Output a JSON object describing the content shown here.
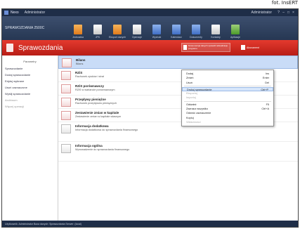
{
  "credit": "fot. InsERT",
  "window": {
    "app_name": "Nexo",
    "app_subtitle": "Administrator",
    "user": "Administrator",
    "controls": [
      "?",
      "–",
      "□",
      "×"
    ]
  },
  "ribbon": {
    "company": "SPRAWOZDANIA 2500C",
    "tools": [
      {
        "label": "Jednostka",
        "color": "orange"
      },
      {
        "label": "JPK",
        "color": "white"
      },
      {
        "label": "Eksport danych",
        "color": "orange"
      },
      {
        "label": "Operacje",
        "color": "white"
      },
      {
        "label": "Wydruki",
        "color": "blue"
      },
      {
        "label": "Kalendarz",
        "color": "blue"
      },
      {
        "label": "Dokumenty",
        "color": "blue"
      },
      {
        "label": "Kontakty",
        "color": "white"
      },
      {
        "label": "Aplikacje",
        "color": "green"
      }
    ]
  },
  "section": {
    "title": "Sprawozdania",
    "notice": "Nowa wersja danych\nsprawdź aktualizacje programu",
    "abonament": "Abonament"
  },
  "sidebar": {
    "header": "Parametry",
    "items": [
      {
        "label": "Sprawozdanie",
        "muted": false
      },
      {
        "label": "Dodaj sprawozdanie",
        "muted": false
      },
      {
        "label": "Edytuj wybrane",
        "muted": false
      },
      {
        "label": "Usuń zaznaczone",
        "muted": false
      },
      {
        "label": "Wyślij sprawozdanie",
        "muted": false
      },
      {
        "label": "Archiwum",
        "muted": true
      },
      {
        "label": "Więcej operacji",
        "muted": true
      }
    ]
  },
  "list": [
    {
      "title": "Bilans",
      "desc": "Bilans",
      "selected": true,
      "gray": false,
      "tall": false
    },
    {
      "title": "RZiS",
      "desc": "Rachunek zysków i strat",
      "selected": false,
      "gray": false,
      "tall": false
    },
    {
      "title": "RZiS porównawczy",
      "desc": "RZiS w wariancie porównawczym",
      "selected": false,
      "gray": false,
      "tall": false
    },
    {
      "title": "Przepływy pieniężne",
      "desc": "Rachunek przepływów pieniężnych",
      "selected": false,
      "gray": false,
      "tall": false
    },
    {
      "title": "Zestawienie zmian w kapitale",
      "desc": "Zestawienie zmian w kapitale własnym",
      "selected": false,
      "gray": false,
      "tall": false
    },
    {
      "title": "Informacja dodatkowa",
      "desc": "Informacja dodatkowa do sprawozdania finansowego",
      "selected": false,
      "gray": true,
      "tall": true
    },
    {
      "title": "Informacja ogólna",
      "desc": "Wprowadzenie do sprawozdania finansowego",
      "selected": false,
      "gray": true,
      "tall": true
    }
  ],
  "context_menu": [
    {
      "label": "Dodaj",
      "shortcut": "Ins",
      "disabled": false,
      "highlight": false
    },
    {
      "label": "Zmień",
      "shortcut": "Enter",
      "disabled": false,
      "highlight": false
    },
    {
      "label": "Usuń",
      "shortcut": "Del",
      "disabled": false,
      "highlight": false
    },
    {
      "sep": true
    },
    {
      "label": "Drukuj sprawozdanie",
      "shortcut": "Ctrl+P",
      "disabled": false,
      "highlight": true
    },
    {
      "label": "Eksportuj",
      "shortcut": "",
      "disabled": true,
      "highlight": false
    },
    {
      "label": "Importuj",
      "shortcut": "",
      "disabled": true,
      "highlight": false
    },
    {
      "sep": true
    },
    {
      "label": "Odśwież",
      "shortcut": "F5",
      "disabled": false,
      "highlight": false
    },
    {
      "label": "Zaznacz wszystko",
      "shortcut": "Ctrl+A",
      "disabled": false,
      "highlight": false
    },
    {
      "label": "Odwróć zaznaczenie",
      "shortcut": "",
      "disabled": false,
      "highlight": false
    },
    {
      "label": "Kopiuj",
      "shortcut": "",
      "disabled": false,
      "highlight": false
    },
    {
      "label": "Właściwości",
      "shortcut": "",
      "disabled": true,
      "highlight": false
    }
  ],
  "status": "Użytkownik: Administrator   Baza danych: Sprawozdania   Serwer: (local)"
}
